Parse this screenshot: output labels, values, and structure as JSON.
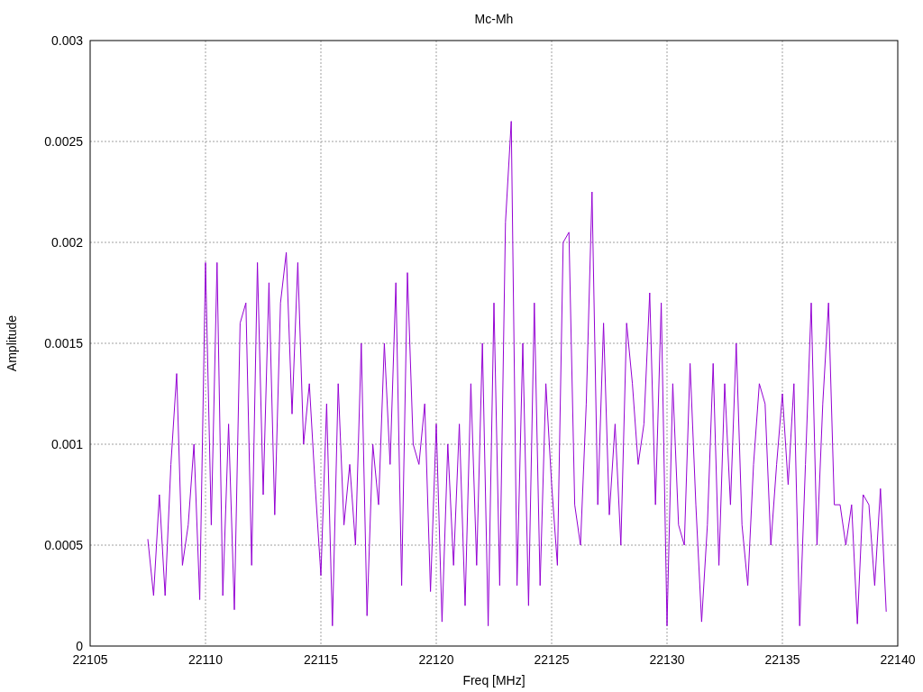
{
  "chart": {
    "chart_data": {
      "type": "line",
      "title": "Mc-Mh",
      "xlabel": "Freq [MHz]",
      "ylabel": "Amplitude",
      "xlim": [
        22105,
        22140
      ],
      "ylim": [
        0,
        0.003
      ],
      "xticks": [
        22105,
        22110,
        22115,
        22120,
        22125,
        22130,
        22135,
        22140
      ],
      "yticks": [
        0,
        0.0005,
        0.001,
        0.0015,
        0.002,
        0.0025,
        0.003
      ],
      "x": [
        22107.5,
        22107.75,
        22108,
        22108.25,
        22108.5,
        22108.75,
        22109,
        22109.25,
        22109.5,
        22109.75,
        22110,
        22110.25,
        22110.5,
        22110.75,
        22111,
        22111.25,
        22111.5,
        22111.75,
        22112,
        22112.25,
        22112.5,
        22112.75,
        22113,
        22113.25,
        22113.5,
        22113.75,
        22114,
        22114.25,
        22114.5,
        22114.75,
        22115,
        22115.25,
        22115.5,
        22115.75,
        22116,
        22116.25,
        22116.5,
        22116.75,
        22117,
        22117.25,
        22117.5,
        22117.75,
        22118,
        22118.25,
        22118.5,
        22118.75,
        22119,
        22119.25,
        22119.5,
        22119.75,
        22120,
        22120.25,
        22120.5,
        22120.75,
        22121,
        22121.25,
        22121.5,
        22121.75,
        22122,
        22122.25,
        22122.5,
        22122.75,
        22123,
        22123.25,
        22123.5,
        22123.75,
        22124,
        22124.25,
        22124.5,
        22124.75,
        22125,
        22125.25,
        22125.5,
        22125.75,
        22126,
        22126.25,
        22126.5,
        22126.75,
        22127,
        22127.25,
        22127.5,
        22127.75,
        22128,
        22128.25,
        22128.5,
        22128.75,
        22129,
        22129.25,
        22129.5,
        22129.75,
        22130,
        22130.25,
        22130.5,
        22130.75,
        22131,
        22131.25,
        22131.5,
        22131.75,
        22132,
        22132.25,
        22132.5,
        22132.75,
        22133,
        22133.25,
        22133.5,
        22133.75,
        22134,
        22134.25,
        22134.5,
        22134.75,
        22135,
        22135.25,
        22135.5,
        22135.75,
        22136,
        22136.25,
        22136.5,
        22136.75,
        22137,
        22137.25,
        22137.5,
        22137.75,
        22138,
        22138.25,
        22138.5,
        22138.75,
        22139,
        22139.25,
        22139.5
      ],
      "grid": true,
      "series": [
        {
          "color": "#9400d3",
          "values": [
            0.00053,
            0.00025,
            0.00075,
            0.00025,
            0.0009,
            0.00135,
            0.0004,
            0.0006,
            0.001,
            0.00023,
            0.0019,
            0.0006,
            0.0019,
            0.00025,
            0.0011,
            0.00018,
            0.0016,
            0.0017,
            0.0004,
            0.0019,
            0.00075,
            0.0018,
            0.00065,
            0.0017,
            0.00195,
            0.00115,
            0.0019,
            0.001,
            0.0013,
            0.0008,
            0.00035,
            0.0012,
            0.0001,
            0.0013,
            0.0006,
            0.0009,
            0.0005,
            0.0015,
            0.00015,
            0.001,
            0.0007,
            0.0015,
            0.0009,
            0.0018,
            0.0003,
            0.00185,
            0.001,
            0.0009,
            0.0012,
            0.00027,
            0.0011,
            0.00012,
            0.001,
            0.0004,
            0.0011,
            0.0002,
            0.0013,
            0.0004,
            0.0015,
            0.0001,
            0.0017,
            0.0003,
            0.0021,
            0.0026,
            0.0003,
            0.0015,
            0.0002,
            0.0017,
            0.0003,
            0.0013,
            0.0008,
            0.0004,
            0.002,
            0.00205,
            0.0007,
            0.0005,
            0.0012,
            0.00225,
            0.0007,
            0.0016,
            0.00065,
            0.0011,
            0.0005,
            0.0016,
            0.0013,
            0.0009,
            0.0011,
            0.00175,
            0.0007,
            0.0017,
            0.0001,
            0.0013,
            0.0006,
            0.0005,
            0.0014,
            0.0007,
            0.00012,
            0.0006,
            0.0014,
            0.0004,
            0.0013,
            0.0007,
            0.0015,
            0.0006,
            0.0003,
            0.0009,
            0.0013,
            0.0012,
            0.0005,
            0.0009,
            0.00125,
            0.0008,
            0.0013,
            0.0001,
            0.0009,
            0.0017,
            0.0005,
            0.0012,
            0.0017,
            0.0007,
            0.0007,
            0.0005,
            0.0007,
            0.00011,
            0.00075,
            0.0007,
            0.0003,
            0.00078,
            0.00017
          ]
        }
      ]
    }
  }
}
